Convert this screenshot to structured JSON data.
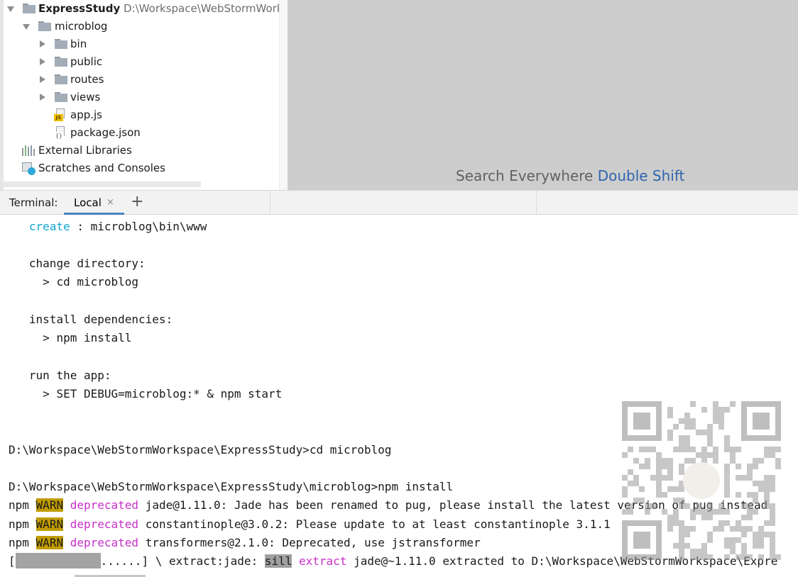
{
  "project": {
    "root": {
      "name": "ExpressStudy",
      "path": "D:\\Workspace\\WebStormWorksp"
    },
    "items": [
      {
        "label": "microblog"
      },
      {
        "label": "bin"
      },
      {
        "label": "public"
      },
      {
        "label": "routes"
      },
      {
        "label": "views"
      },
      {
        "label": "app.js",
        "badge": "JS"
      },
      {
        "label": "package.json",
        "badge": "{}"
      },
      {
        "label": "External Libraries"
      },
      {
        "label": "Scratches and Consoles"
      }
    ]
  },
  "editor": {
    "hint_text": "Search Everywhere",
    "hint_shortcut": "Double Shift"
  },
  "terminal": {
    "title": "Terminal:",
    "tab_label": "Local",
    "close_glyph": "×",
    "new_tab_glyph": "+",
    "lines": [
      {
        "create_word": "create",
        "rest": " : microblog\\bin\\www"
      },
      {
        "text": "change directory:"
      },
      {
        "text": "  > cd microblog"
      },
      {
        "text": "install dependencies:"
      },
      {
        "text": "  > npm install"
      },
      {
        "text": "run the app:"
      },
      {
        "text": "  > SET DEBUG=microblog:* & npm start"
      },
      {
        "text": "D:\\Workspace\\WebStormWorkspace\\ExpressStudy>cd microblog"
      },
      {
        "text": "D:\\Workspace\\WebStormWorkspace\\ExpressStudy\\microblog>npm install"
      }
    ],
    "warnings": [
      {
        "npm": "npm",
        "level": "WARN",
        "tag": "deprecated",
        "message": "jade@1.11.0: Jade has been renamed to pug, please install the latest version of pug instead"
      },
      {
        "npm": "npm",
        "level": "WARN",
        "tag": "deprecated",
        "message": "constantinople@3.0.2: Please update to at least constantinople 3.1.1"
      },
      {
        "npm": "npm",
        "level": "WARN",
        "tag": "deprecated",
        "message": "transformers@2.1.0: Deprecated, use jstransformer"
      }
    ],
    "progress": {
      "open": "[",
      "dots": "......] \\ extract:jade:",
      "level": "sill",
      "action": "extract",
      "message": "jade@~1.11.0 extracted to D:\\Workspace\\WebStormWorkspace\\Expre"
    }
  },
  "colors": {
    "accent": "#4a83c4",
    "cyan": "#11a8cd",
    "magenta": "#c730c7",
    "warn_bg": "#c19c00",
    "hint_link": "#2f65ae"
  }
}
